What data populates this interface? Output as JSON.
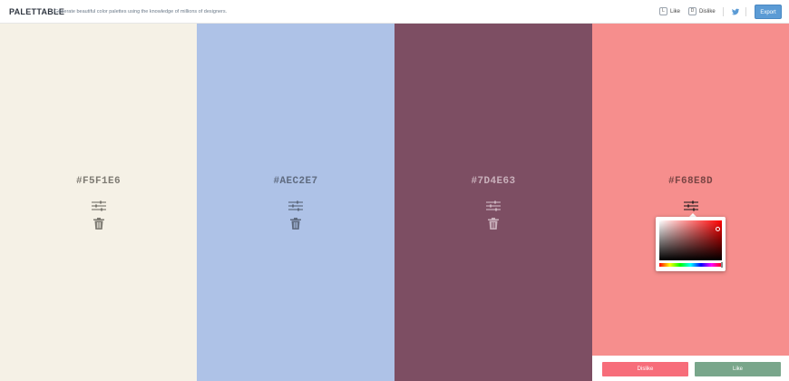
{
  "header": {
    "brand": "PALETTABLE",
    "tagline": "Generate beautiful color palettes using the knowledge of millions of designers.",
    "like_key": "L",
    "like_label": "Like",
    "dislike_key": "D",
    "dislike_label": "Dislike",
    "export_label": "Export"
  },
  "palette": {
    "swatches": [
      {
        "hex": "#F5F1E6",
        "color": "#F5F1E6",
        "text_color": "#7d7a72",
        "icon_color": "#7d7a72"
      },
      {
        "hex": "#AEC2E7",
        "color": "#AEC2E7",
        "text_color": "#5f6b80",
        "icon_color": "#5f6b80"
      },
      {
        "hex": "#7D4E63",
        "color": "#7D4E63",
        "text_color": "#c9b0bb",
        "icon_color": "#c9b0bb"
      },
      {
        "hex": "#F68E8D",
        "color": "#F68E8D",
        "text_color": "#7a4544",
        "icon_color": "#3b2a2a"
      }
    ]
  },
  "vote": {
    "dislike_label": "Dislike",
    "like_label": "Like"
  }
}
